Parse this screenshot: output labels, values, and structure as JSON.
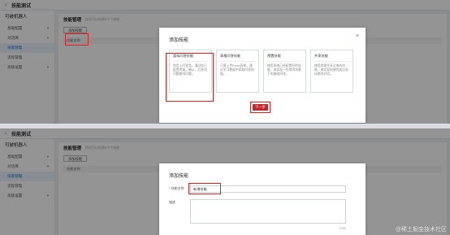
{
  "app": {
    "title": "技能测试",
    "back_icon": "back-arrow-icon"
  },
  "sidebar": {
    "heading": "可被机器人",
    "items": [
      {
        "label": "基础配置",
        "has_chevron": true
      },
      {
        "label": "对话库",
        "has_chevron": true
      },
      {
        "label": "技能管理",
        "has_chevron": false,
        "active": true
      },
      {
        "label": "流程管理",
        "has_chevron": false
      },
      {
        "label": "高级设置",
        "has_chevron": true
      }
    ]
  },
  "main": {
    "title": "技能管理",
    "hint": "你还可以创建8个个技能",
    "add_button": "添加技能",
    "table_header": "技能名称"
  },
  "add_skill_modal": {
    "title": "添加技能",
    "close_icon": "close-icon",
    "cards": [
      {
        "name": "类似问答技能",
        "desc": "常用上问答类，通过你已配置库量。确认，后直决问题解决问题。"
      },
      {
        "name": "表格问答技能",
        "desc": "只需上传Excel表格，通过学习数据中获取问答技能。"
      },
      {
        "name": "预置技能",
        "desc": "使用系统已经配置好的技能，来实现一些常用场景下的基础问答。"
      },
      {
        "name": "共享技能",
        "desc": "使用其他共享过来的技能，来实现快速完成自身技能的对话。"
      }
    ],
    "next_button": "下一步"
  },
  "name_form_modal": {
    "title": "添加技能",
    "name_label": "技能名称",
    "required_mark": "*",
    "name_value": "新增技能",
    "desc_label": "描述",
    "desc_placeholder": "",
    "counter": "0/255"
  },
  "colors": {
    "primary": "#c5262a",
    "annotation": "#e02020",
    "active_nav": "#1f6fd1"
  },
  "watermark": "@稀土掘金技术社区"
}
